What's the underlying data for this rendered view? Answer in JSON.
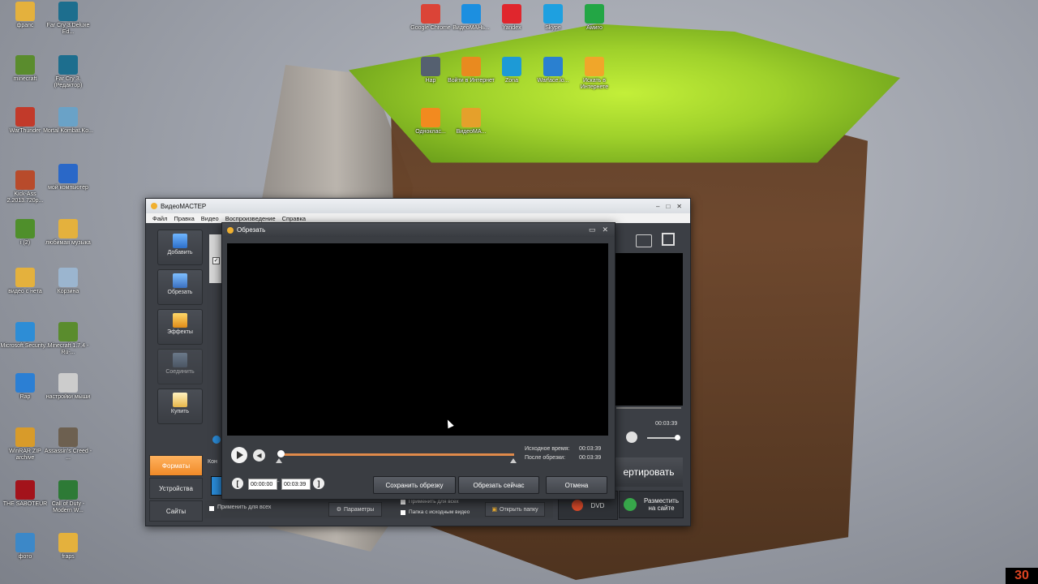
{
  "desktop": {
    "icons": [
      {
        "label": "фрапс",
        "icon": "folder-icon",
        "color": "#e4b13d"
      },
      {
        "label": "Far Cry 3.Deluxe Ed...",
        "icon": "farcry-icon",
        "color": "#1d6e8e"
      },
      {
        "label": "minecraft",
        "icon": "minecraft-icon",
        "color": "#5a8c2d"
      },
      {
        "label": "Far Cry 3.(Редактор)",
        "icon": "farcry-icon",
        "color": "#1d6e8e"
      },
      {
        "label": "WarThunder",
        "icon": "warthunder-icon",
        "color": "#c23a2a"
      },
      {
        "label": "Mortal Kombat.Ko...",
        "icon": "mortalkombat-icon",
        "color": "#6aa2c7"
      },
      {
        "label": "Kick-Ass 2.2013.720p...",
        "icon": "video-icon",
        "color": "#b84b2b"
      },
      {
        "label": "мой компьютер",
        "icon": "computer-icon",
        "color": "#2a68c8"
      },
      {
        "label": "i (2)",
        "icon": "minecraft-icon",
        "color": "#4f8f2b"
      },
      {
        "label": "любимая музыка",
        "icon": "folder-icon",
        "color": "#e4b13d"
      },
      {
        "label": "видео с нета",
        "icon": "folder-icon",
        "color": "#e4b13d"
      },
      {
        "label": "Корзина",
        "icon": "recycle-bin-icon",
        "color": "#9bb5cf"
      },
      {
        "label": "Microsoft Security...",
        "icon": "security-icon",
        "color": "#2d8dd6"
      },
      {
        "label": "Minecraft 1.7.4 - Ru-...",
        "icon": "minecraft-icon",
        "color": "#5a8c2d"
      },
      {
        "label": "Rap",
        "icon": "globe-icon",
        "color": "#2b7fd4"
      },
      {
        "label": "настройки мыши",
        "icon": "mouse-icon",
        "color": "#cccccc"
      },
      {
        "label": "WinRAR ZIP archive",
        "icon": "winrar-icon",
        "color": "#d89b2a"
      },
      {
        "label": "Assassin's Creed - ...",
        "icon": "game-icon",
        "color": "#6d6050"
      },
      {
        "label": "THE SABOTEUR",
        "icon": "game-icon",
        "color": "#a3131b"
      },
      {
        "label": "Call of Duty - Modern W...",
        "icon": "game-icon",
        "color": "#2d7a36"
      },
      {
        "label": "фото",
        "icon": "image-icon",
        "color": "#3c88c8"
      },
      {
        "label": "fraps",
        "icon": "folder-icon",
        "color": "#e4b13d"
      },
      {
        "label": "Google Chrome",
        "icon": "chrome-icon",
        "color": "#db4437"
      },
      {
        "label": "ВидеоМАНь...",
        "icon": "videomaster-icon",
        "color": "#1c8fe0"
      },
      {
        "label": "Yandex",
        "icon": "yandex-icon",
        "color": "#e0262d"
      },
      {
        "label": "Skype",
        "icon": "skype-icon",
        "color": "#1ea0e0"
      },
      {
        "label": "Амиго",
        "icon": "amigo-icon",
        "color": "#23a645"
      },
      {
        "label": "Hap",
        "icon": "app-icon",
        "color": "#556070"
      },
      {
        "label": "Войти в Интернет",
        "icon": "internet-icon",
        "color": "#e98a1f"
      },
      {
        "label": "Zona",
        "icon": "zona-icon",
        "color": "#1d9ad6"
      },
      {
        "label": "Warface.lo...",
        "icon": "download-icon",
        "color": "#2a80d0"
      },
      {
        "label": "Искать в Интернете",
        "icon": "search-icon",
        "color": "#f0a62a"
      },
      {
        "label": "Одноклас...",
        "icon": "odnoklassniki-icon",
        "color": "#f28a1f"
      },
      {
        "label": "ВидеоМА...",
        "icon": "videomaster-icon",
        "color": "#e5a02b"
      }
    ]
  },
  "main_window": {
    "title": "ВидеоМАСТЕР",
    "menu": [
      "Файл",
      "Правка",
      "Видео",
      "Воспроизведение",
      "Справка"
    ],
    "sidebar": [
      {
        "label": "Добавить",
        "icon": "add-video-icon"
      },
      {
        "label": "Обрезать",
        "icon": "cut-icon"
      },
      {
        "label": "Эффекты",
        "icon": "effects-icon"
      },
      {
        "label": "Соединить",
        "icon": "join-icon"
      },
      {
        "label": "Купить",
        "icon": "cart-icon"
      }
    ],
    "tabs": [
      "Форматы",
      "Устройства",
      "Сайты"
    ],
    "right_panel": {
      "time": "00:03:39",
      "convert_label": "ертировать",
      "dvd_label": "DVD",
      "upload_label": "Разместить на сайте"
    },
    "bottom": {
      "apply_all": "Применить для всех",
      "params": "Параметры",
      "apply_all_2": "Применить для всех",
      "source_folder": "Папка с исходным видео",
      "open_folder": "Открыть папку",
      "kon_label": "Кон"
    }
  },
  "crop_dialog": {
    "title": "Обрезать",
    "source_time_label": "Исходное время:",
    "source_time": "00:03:39",
    "after_crop_label": "После обрезки:",
    "after_crop_time": "00:03:39",
    "start_time": "00:00:00",
    "end_time": "00:03:39",
    "save_button": "Сохранить обрезку",
    "crop_now_button": "Обрезать сейчас",
    "cancel_button": "Отмена"
  },
  "corner_badge": "30"
}
